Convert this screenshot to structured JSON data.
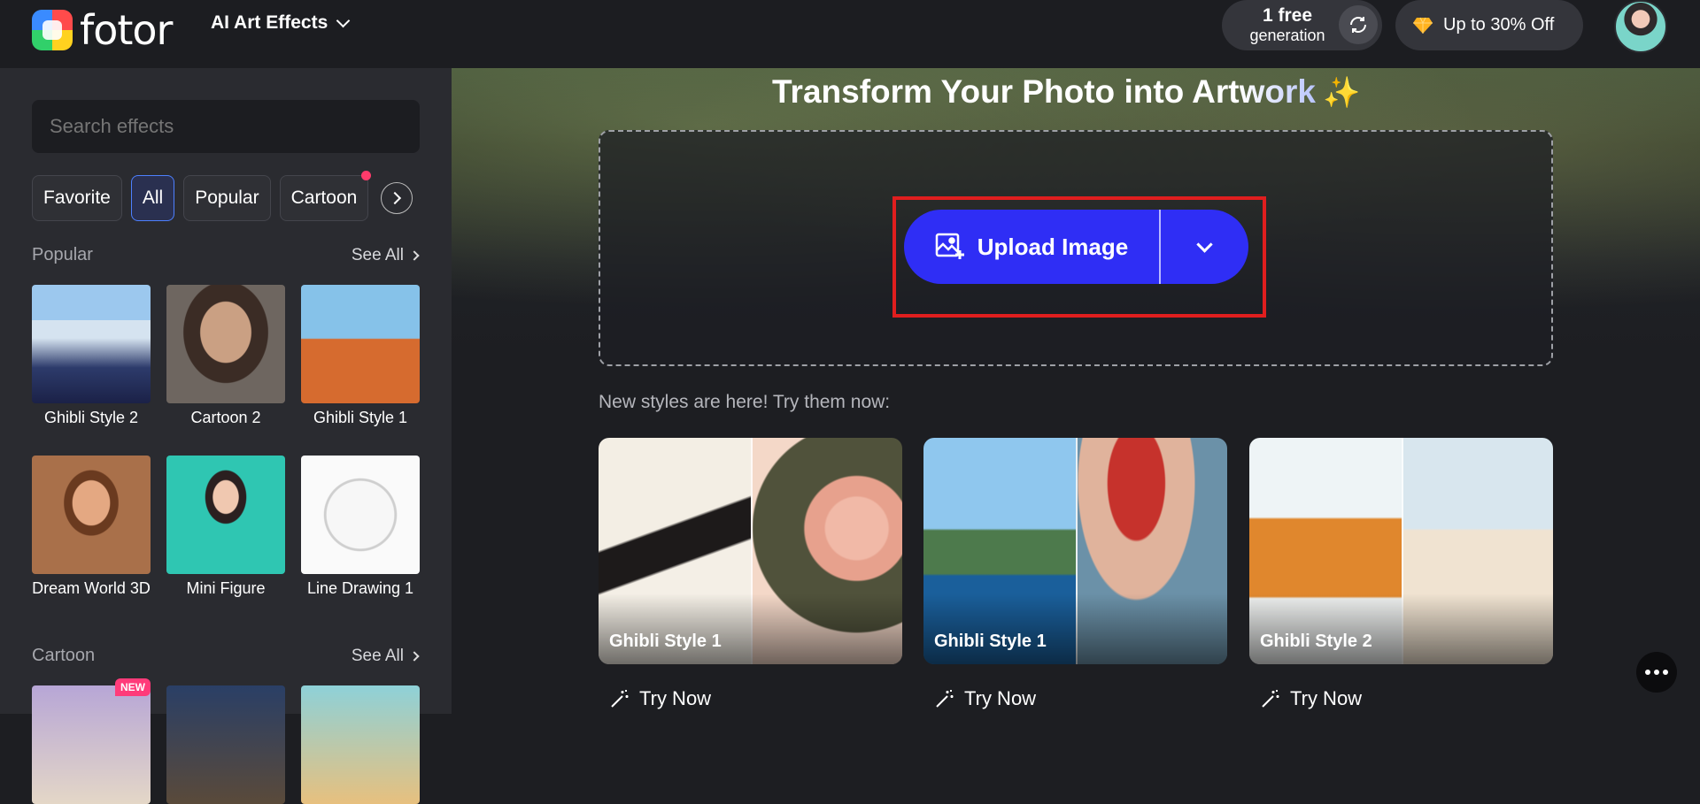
{
  "header": {
    "logo_text": "fotor",
    "menu_label": "AI Art Effects",
    "credits_count": "1 free",
    "credits_unit": "generation",
    "promo_label": "Up to 30% Off"
  },
  "sidebar": {
    "search_placeholder": "Search effects",
    "chips": [
      {
        "label": "Favorite"
      },
      {
        "label": "All",
        "active": true
      },
      {
        "label": "Popular"
      },
      {
        "label": "Cartoon",
        "dot": true
      }
    ],
    "sections": [
      {
        "title": "Popular",
        "see_all": "See All",
        "items": [
          {
            "label": "Ghibli Style 2"
          },
          {
            "label": "Cartoon 2"
          },
          {
            "label": "Ghibli Style 1"
          },
          {
            "label": "Dream World 3D"
          },
          {
            "label": "Mini Figure"
          },
          {
            "label": "Line Drawing 1"
          }
        ]
      },
      {
        "title": "Cartoon",
        "see_all": "See All",
        "new_badge": "NEW"
      }
    ]
  },
  "main": {
    "title_prefix": "Transform Your Photo into Art",
    "title_accent": "work",
    "upload_label": "Upload Image",
    "new_styles_text": "New styles are here! Try them now:",
    "cards": [
      {
        "label": "Ghibli Style 1",
        "cta": "Try Now"
      },
      {
        "label": "Ghibli Style 1",
        "cta": "Try Now"
      },
      {
        "label": "Ghibli Style 2",
        "cta": "Try Now"
      }
    ]
  },
  "icons": {
    "refresh": "refresh-icon",
    "gem": "gem-icon",
    "upload": "image-add-icon",
    "wand": "magic-wand-icon",
    "more": "more-dots-icon"
  },
  "colors": {
    "primary_button": "#2f2ef5",
    "highlight_border": "#e01e1e",
    "active_chip_border": "#4d80ff",
    "new_badge": "#ff3b7a"
  }
}
